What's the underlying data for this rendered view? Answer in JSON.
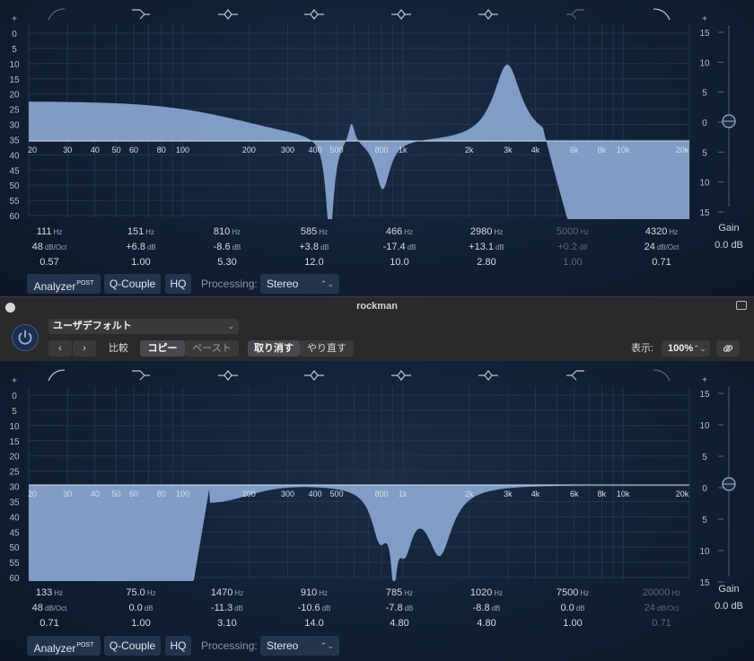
{
  "colors": {
    "fill": "#8aa7d3",
    "accent": "#6f96d2",
    "grid": "#223550",
    "text": "#c9d2de",
    "dim": "#5e6a7a"
  },
  "db_scale": [
    "+",
    "0",
    "5",
    "10",
    "15",
    "20",
    "25",
    "30",
    "35",
    "40",
    "45",
    "50",
    "55",
    "60"
  ],
  "top": {
    "freq_axis": [
      "20",
      "30",
      "40",
      "50",
      "60",
      "80",
      "100",
      "200",
      "300",
      "400",
      "500",
      "800",
      "1k",
      "2k",
      "3k",
      "4k",
      "6k",
      "8k",
      "10k",
      "20k"
    ],
    "gain_scale": [
      "+",
      "15",
      "10",
      "5",
      "0",
      "5",
      "10",
      "15"
    ],
    "gain_label": "Gain",
    "gain_value": "0.0 dB",
    "bands": [
      {
        "type": "lowcut-icon",
        "freq": "111",
        "freq_unit": "Hz",
        "gain": "48",
        "gain_unit": "dB/Oct",
        "q": "0.57",
        "active": false
      },
      {
        "type": "lowshelf-icon",
        "freq": "151",
        "freq_unit": "Hz",
        "gain": "+6.8",
        "gain_unit": "dB",
        "q": "1.00",
        "active": true
      },
      {
        "type": "bell-icon",
        "freq": "810",
        "freq_unit": "Hz",
        "gain": "-8.6",
        "gain_unit": "dB",
        "q": "5.30",
        "active": true
      },
      {
        "type": "bell-icon",
        "freq": "585",
        "freq_unit": "Hz",
        "gain": "+3.8",
        "gain_unit": "dB",
        "q": "12.0",
        "active": true
      },
      {
        "type": "bell-icon",
        "freq": "466",
        "freq_unit": "Hz",
        "gain": "-17.4",
        "gain_unit": "dB",
        "q": "10.0",
        "active": true
      },
      {
        "type": "bell-icon",
        "freq": "2980",
        "freq_unit": "Hz",
        "gain": "+13.1",
        "gain_unit": "dB",
        "q": "2.80",
        "active": true
      },
      {
        "type": "highshelf-icon",
        "freq": "5000",
        "freq_unit": "Hz",
        "gain": "+0.2",
        "gain_unit": "dB",
        "q": "1.00",
        "active": false
      },
      {
        "type": "highcut-icon",
        "freq": "4320",
        "freq_unit": "Hz",
        "gain": "24",
        "gain_unit": "dB/Oct",
        "q": "0.71",
        "active": true
      }
    ]
  },
  "bottom": {
    "freq_axis": [
      "20",
      "30",
      "40",
      "50",
      "60",
      "80",
      "100",
      "200",
      "300",
      "400",
      "500",
      "800",
      "1k",
      "2k",
      "3k",
      "4k",
      "6k",
      "8k",
      "10k",
      "20k"
    ],
    "gain_scale": [
      "+",
      "15",
      "10",
      "5",
      "0",
      "5",
      "10",
      "15"
    ],
    "gain_label": "Gain",
    "gain_value": "0.0 dB",
    "bands": [
      {
        "type": "lowcut-icon",
        "freq": "133",
        "freq_unit": "Hz",
        "gain": "48",
        "gain_unit": "dB/Oct",
        "q": "0.71",
        "active": true
      },
      {
        "type": "lowshelf-icon",
        "freq": "75.0",
        "freq_unit": "Hz",
        "gain": "0.0",
        "gain_unit": "dB",
        "q": "1.00",
        "active": true
      },
      {
        "type": "bell-icon",
        "freq": "1470",
        "freq_unit": "Hz",
        "gain": "-11.3",
        "gain_unit": "dB",
        "q": "3.10",
        "active": true
      },
      {
        "type": "bell-icon",
        "freq": "910",
        "freq_unit": "Hz",
        "gain": "-10.6",
        "gain_unit": "dB",
        "q": "14.0",
        "active": true
      },
      {
        "type": "bell-icon",
        "freq": "785",
        "freq_unit": "Hz",
        "gain": "-7.8",
        "gain_unit": "dB",
        "q": "4.80",
        "active": true
      },
      {
        "type": "bell-icon",
        "freq": "1020",
        "freq_unit": "Hz",
        "gain": "-8.8",
        "gain_unit": "dB",
        "q": "4.80",
        "active": true
      },
      {
        "type": "highshelf-icon",
        "freq": "7500",
        "freq_unit": "Hz",
        "gain": "0.0",
        "gain_unit": "dB",
        "q": "1.00",
        "active": true
      },
      {
        "type": "highcut-icon",
        "freq": "20000",
        "freq_unit": "Hz",
        "gain": "24",
        "gain_unit": "dB/Oct",
        "q": "0.71",
        "active": false
      }
    ]
  },
  "bottom_bar": {
    "analyzer": "Analyzer",
    "analyzer_sup": "POST",
    "qcouple": "Q-Couple",
    "hq": "HQ",
    "processing_label": "Processing:",
    "processing_value": "Stereo"
  },
  "header": {
    "title": "rockman",
    "preset": "ユーザデフォルト",
    "compare": "比較",
    "copy": "コピー",
    "paste": "ペースト",
    "undo": "取り消す",
    "redo": "やり直す",
    "zoom_label": "表示:",
    "zoom_value": "100%"
  }
}
